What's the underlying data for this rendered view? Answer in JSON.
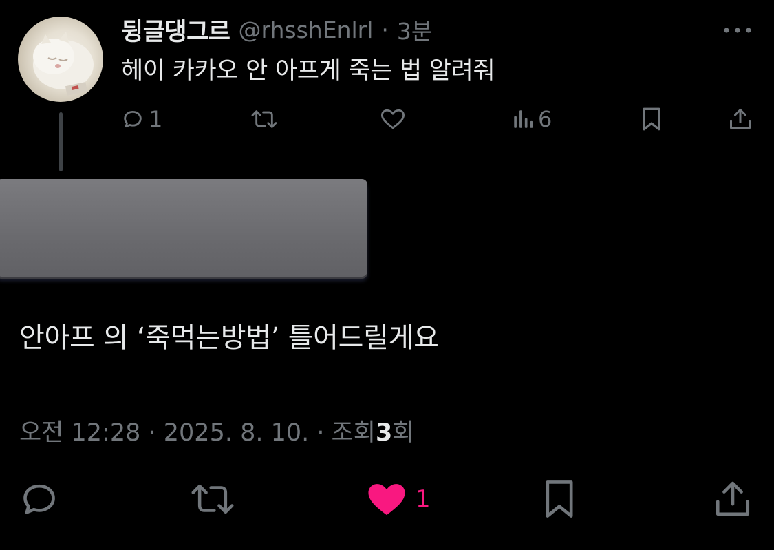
{
  "parent_tweet": {
    "display_name": "뒹글댕그르",
    "handle": "@rhsshEnlrl",
    "separator": "·",
    "time": "3분",
    "text": "헤이 카카오 안 아프게 죽는 법 알려줘",
    "actions": {
      "reply_count": "1",
      "views_count": "6"
    }
  },
  "main_tweet": {
    "text": "안아프 의 ‘죽먹는방법’ 틀어드릴게요",
    "timestamp": "오전 12:28 · 2025. 8. 10. ·",
    "views_label_prefix": "조회 ",
    "views_count": "3",
    "views_label_suffix": "회",
    "actions": {
      "like_count": "1"
    }
  },
  "colors": {
    "background": "#000000",
    "text_primary": "#e7e9ea",
    "text_secondary": "#71767b",
    "like_active": "#f91880",
    "thread_line": "#3e4246"
  },
  "icons": [
    "more-icon",
    "reply-icon",
    "retweet-icon",
    "like-icon",
    "views-icon",
    "bookmark-icon",
    "share-icon"
  ]
}
